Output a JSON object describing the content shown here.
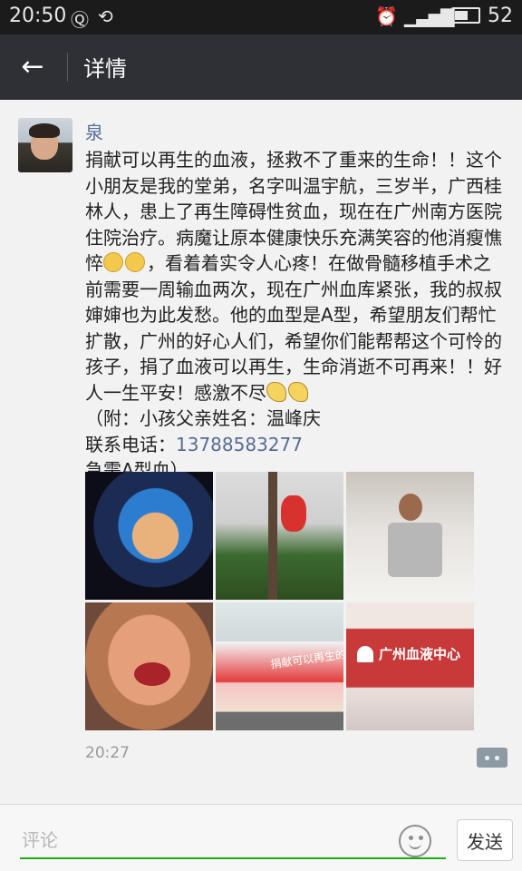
{
  "status_bar": {
    "time": "20:50",
    "icons": [
      "q-app-icon",
      "sync-icon",
      "alarm-icon",
      "signal-icon",
      "battery-icon"
    ],
    "battery": "52"
  },
  "header": {
    "back_icon": "arrow-left-icon",
    "title": "详情"
  },
  "post": {
    "username": "泉",
    "text_lines": [
      "捐献可以再生的血液，拯救不了重来的生命！！这个小朋友是我的堂弟，名字叫温宇航，三岁半，广西桂林人，患上了再生障碍性贫血，现在在广州南方医院住院治疗。病魔让原本健康快乐充满笑容的他消瘦憔悴",
      "，看着着实令人心疼！在做骨髓移植手术之前需要一周输血两次，现在广州血库紧张，我的叔叔婶婶也为此发愁。他的血型是A型，希望朋友们帮忙扩散，广州的好心人们，希望你们能帮帮这个可怜的孩子，捐了血液可以再生，生命消逝不可再来！！好人一生平安！感激不尽",
      "（附：小孩父亲姓名：温峰庆"
    ],
    "contact_label": "联系电话：",
    "phone": "13788583277",
    "urgent": "急需A型血）",
    "photos": [
      {
        "name": "photo-child-hood"
      },
      {
        "name": "photo-child-tree"
      },
      {
        "name": "photo-child-bed"
      },
      {
        "name": "photo-child-mouth"
      },
      {
        "name": "photo-blood-bus",
        "sign": "捐献可以再生的血液"
      },
      {
        "name": "photo-blood-center",
        "sign": "广州血液中心"
      }
    ],
    "time": "20:27"
  },
  "comment_bar": {
    "placeholder": "评论",
    "send_label": "发送",
    "emoji_icon": "smiley-face-icon"
  },
  "colors": {
    "status_bar_bg": "#1b1b1b",
    "title_bar_bg": "#2e3035",
    "username": "#576b95",
    "input_underline": "#1aad19"
  }
}
